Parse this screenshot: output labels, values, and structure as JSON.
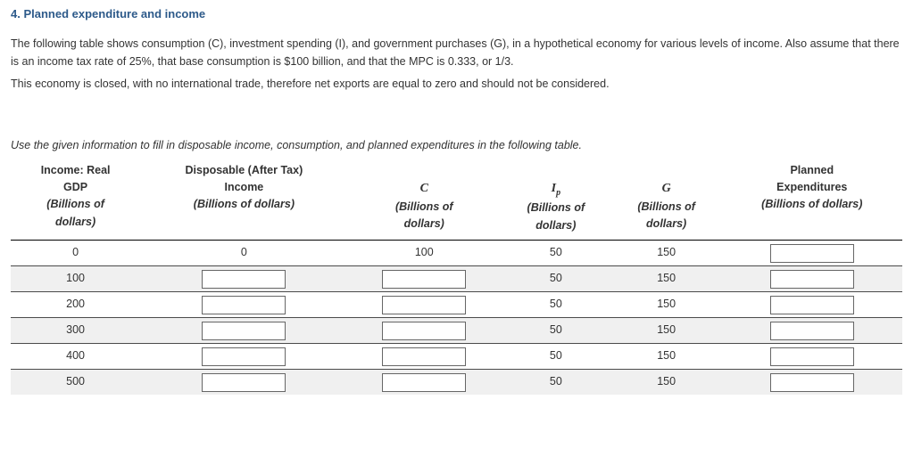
{
  "heading": "4. Planned expenditure and income",
  "intro": {
    "p1": "The following table shows consumption (C), investment spending (I), and government purchases (G), in a hypothetical economy for various levels of income. Also assume that there is an income tax rate of 25%, that base consumption is $100 billion, and that the MPC is 0.333, or 1/3.",
    "p2": "This economy is closed, with no international trade, therefore net exports are equal to zero and should not be considered."
  },
  "instruction": "Use the given information to fill in disposable income, consumption, and planned expenditures in the following table.",
  "headers": {
    "col1": {
      "l1": "Income: Real",
      "l2": "GDP",
      "l3": "(Billions of",
      "l4": "dollars)"
    },
    "col2": {
      "l1": "Disposable (After Tax)",
      "l2": "Income",
      "l3": "(Billions of dollars)"
    },
    "col3": {
      "sym": "C",
      "l3": "(Billions of",
      "l4": "dollars)"
    },
    "col4": {
      "sym": "I",
      "sub": "p",
      "l3": "(Billions of",
      "l4": "dollars)"
    },
    "col5": {
      "sym": "G",
      "l3": "(Billions of",
      "l4": "dollars)"
    },
    "col6": {
      "l1": "Planned",
      "l2": "Expenditures",
      "l3": "(Billions of dollars)"
    }
  },
  "rows": [
    {
      "gdp": "0",
      "disp": "0",
      "c": "100",
      "ip": "50",
      "g": "150",
      "pe_input": true,
      "disp_input": false,
      "c_input": false
    },
    {
      "gdp": "100",
      "disp": "",
      "c": "",
      "ip": "50",
      "g": "150",
      "pe_input": true,
      "disp_input": true,
      "c_input": true
    },
    {
      "gdp": "200",
      "disp": "",
      "c": "",
      "ip": "50",
      "g": "150",
      "pe_input": true,
      "disp_input": true,
      "c_input": true
    },
    {
      "gdp": "300",
      "disp": "",
      "c": "",
      "ip": "50",
      "g": "150",
      "pe_input": true,
      "disp_input": true,
      "c_input": true
    },
    {
      "gdp": "400",
      "disp": "",
      "c": "",
      "ip": "50",
      "g": "150",
      "pe_input": true,
      "disp_input": true,
      "c_input": true
    },
    {
      "gdp": "500",
      "disp": "",
      "c": "",
      "ip": "50",
      "g": "150",
      "pe_input": true,
      "disp_input": true,
      "c_input": true
    }
  ]
}
